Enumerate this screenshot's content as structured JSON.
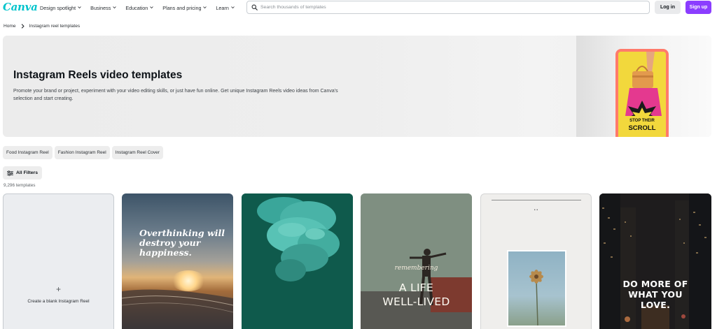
{
  "header": {
    "logo": "Canva",
    "nav": [
      "Design spotlight",
      "Business",
      "Education",
      "Plans and pricing",
      "Learn"
    ],
    "search_placeholder": "Search thousands of templates",
    "login_label": "Log in",
    "signup_label": "Sign up"
  },
  "breadcrumb": {
    "home": "Home",
    "current": "Instagram reel templates"
  },
  "hero": {
    "title": "Instagram Reels video templates",
    "description": "Promote your brand or project, experiment with your video editing skills, or just have fun online. Get unique Instagram Reels video ideas from Canva's selection and start creating.",
    "phone_caption": [
      "STOP THEIR",
      "SCROLL"
    ]
  },
  "chips": [
    "Food Instagram Reel",
    "Fashion Instagram Reel",
    "Instagram Reel Cover"
  ],
  "filters_label": "All Filters",
  "template_count": "9,296 templates",
  "cards": {
    "blank_plus": "+",
    "blank_label": "Create a blank Instagram Reel",
    "beach_text": "Overthinking will destroy your happiness.",
    "person_script": "remembering",
    "person_big_1": "A LIFE",
    "person_big_2": "WELL-LIVED",
    "flower_dots": "• •",
    "city_line_1": "DO MORE OF",
    "city_line_2": "WHAT YOU",
    "city_line_3": "LOVE."
  },
  "colors": {
    "brand_teal": "#00c4cc",
    "signup_purple": "#8b3dff"
  }
}
